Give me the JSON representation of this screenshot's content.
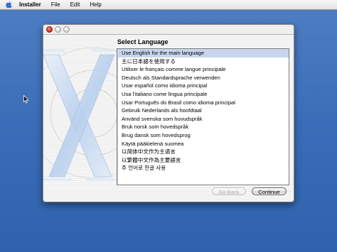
{
  "menubar": {
    "items": [
      {
        "label": "Installer",
        "bold": true
      },
      {
        "label": "File"
      },
      {
        "label": "Edit"
      },
      {
        "label": "Help"
      }
    ]
  },
  "window": {
    "heading": "Select Language",
    "languages": [
      "Use English for the main language",
      "主に日本語を使用する",
      "Utiliser le français comme langue principale",
      "Deutsch als Standardsprache verwenden",
      "Usar español como idioma principal",
      "Usa l'italiano come lingua principale",
      "Usar Português do Brasil como idioma principal",
      "Gebruik Nederlands als hoofdtaal",
      "Använd svenska som huvudspråk",
      "Bruk norsk som hovedspråk",
      "Brug dansk som hovedsprog",
      "Käytä pääkielenä suomea",
      "以简体中文作为主语言",
      "以繁體中文作為主要語言",
      "주 언어로 한글 사용"
    ],
    "selected_index": 0,
    "buttons": {
      "back_label": "Go Back",
      "continue_label": "Continue"
    }
  },
  "colors": {
    "desktop": "#3a6db7",
    "selection": "#c7d6ee"
  }
}
